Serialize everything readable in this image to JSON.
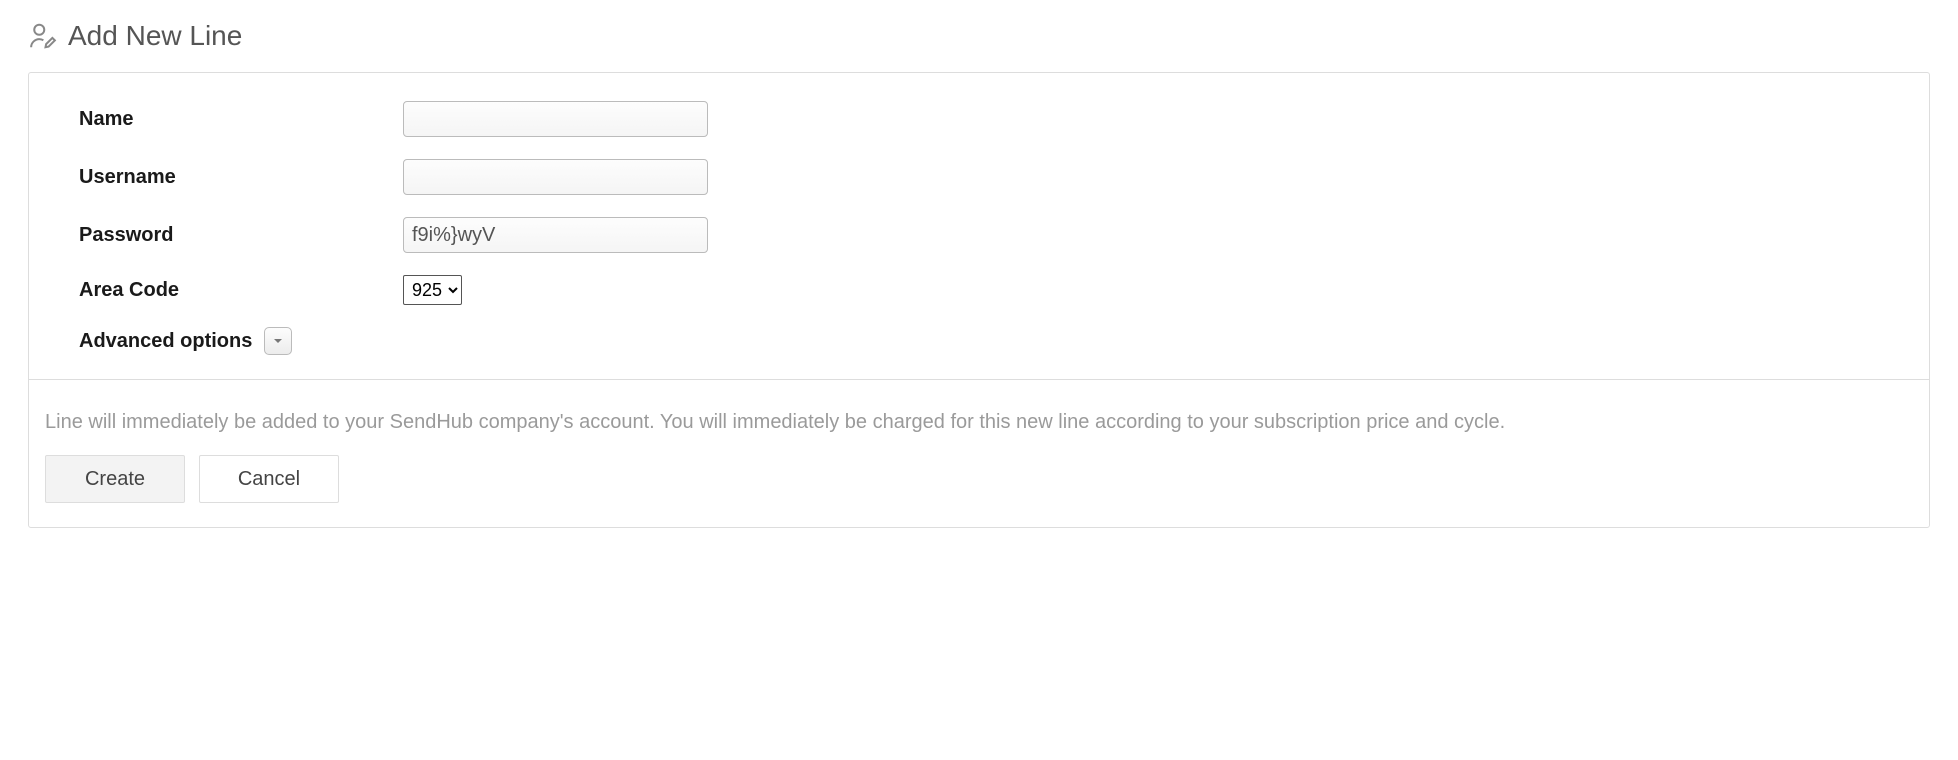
{
  "header": {
    "title": "Add New Line"
  },
  "form": {
    "name": {
      "label": "Name",
      "value": ""
    },
    "username": {
      "label": "Username",
      "value": ""
    },
    "password": {
      "label": "Password",
      "value": "f9i%}wyV"
    },
    "area_code": {
      "label": "Area Code",
      "selected": "925"
    },
    "advanced_label": "Advanced options"
  },
  "footer": {
    "note": "Line will immediately be added to your SendHub company's account. You will immediately be charged for this new line according to your subscription price and cycle.",
    "create_label": "Create",
    "cancel_label": "Cancel"
  }
}
